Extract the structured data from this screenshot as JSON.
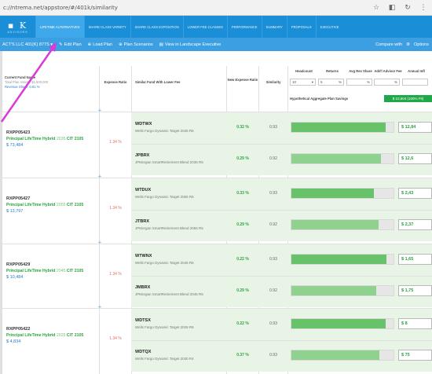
{
  "browser": {
    "url": "c://ntrema.net/appstore/#/401k/similarity",
    "icons": [
      "star-icon",
      "extensions-icon",
      "refresh-icon",
      "menu-icon"
    ]
  },
  "brand": {
    "logo": "▪ K",
    "logo_sub": "ADVISORS"
  },
  "nav": {
    "tabs": [
      {
        "label": "Lifetime Alternatives",
        "active": true
      },
      {
        "label": "Share Class Variety",
        "active": false
      },
      {
        "label": "Share Class Exposition",
        "active": false
      },
      {
        "label": "Lower Fee Classes",
        "active": false
      },
      {
        "label": "Performance",
        "active": false
      },
      {
        "label": "Summary",
        "active": false
      },
      {
        "label": "Proposals",
        "active": false
      },
      {
        "label": "Executive",
        "active": false
      }
    ]
  },
  "subbar": {
    "plan": "ACT'S LLC 401(K) 877S ▾",
    "actions": [
      {
        "icon": "edit-icon",
        "label": "Edit Plan"
      },
      {
        "icon": "plus-icon",
        "label": "Load Plan"
      },
      {
        "icon": "plus-icon",
        "label": "Plan Scenarios"
      },
      {
        "icon": "list-icon",
        "label": "View in Landscape Executive"
      }
    ],
    "compare": "Compare with",
    "options": "Options"
  },
  "table": {
    "headers": {
      "current": "Current Fund Name",
      "current_sub1": "Total Plan Assets: $1,500,000",
      "current_sub2": "Revenue Share: 0.81 %",
      "expense": "Expense Ratio",
      "similar": "Similar Fund With Lower Fee",
      "new_expense": "New Expense Ratio",
      "similarity": "Similarity"
    },
    "filters": {
      "headers": [
        "Headcount",
        "Returns",
        "Avg Rev Share",
        "Add'l Advisor Fee",
        "Annual Infl"
      ],
      "values": [
        "10",
        "5",
        "",
        "",
        ""
      ],
      "units": [
        "▾",
        "%",
        "%",
        "%",
        ""
      ],
      "savings_label": "Hypothetical Aggregate Plan Savings",
      "savings_value": "$ 10,604 (100% Fit)"
    },
    "groups": [
      {
        "ticker": "RXPP05423",
        "name": "Principal LifeTime Hybrid",
        "year": "2035",
        "cit": "CIT 2105",
        "amount": "$ 73,484",
        "expense": "1.34 %",
        "similar": [
          {
            "ticker": "WDTWX",
            "name": "Wells Fargo Dynamic Target 2035 R6",
            "new_exp": "0.32 %",
            "similarity": "0.93",
            "fit": 0.92,
            "saving": "$ 12,84"
          },
          {
            "ticker": "JPBRX",
            "name": "JPMorgan SmartRetirement Blend 2035 R5",
            "new_exp": "0.29 %",
            "similarity": "0.92",
            "fit": 0.88,
            "saving": "$ 12,6"
          }
        ]
      },
      {
        "ticker": "RXPP05427",
        "name": "Principal LifeTime Hybrid",
        "year": "2055",
        "cit": "CIT 2105",
        "amount": "$ 13,797",
        "expense": "1.34 %",
        "similar": [
          {
            "ticker": "WTDUX",
            "name": "Wells Fargo Dynamic Target 2055 R6",
            "new_exp": "0.33 %",
            "similarity": "0.93",
            "fit": 0.81,
            "saving": "$ 2,43"
          },
          {
            "ticker": "JTBRX",
            "name": "JPMorgan SmartRetirement Blend 2055 R5",
            "new_exp": "0.29 %",
            "similarity": "0.92",
            "fit": 0.85,
            "saving": "$ 2,37"
          }
        ]
      },
      {
        "ticker": "RXPP05429",
        "name": "Principal LifeTime Hybrid",
        "year": "2045",
        "cit": "CIT 2105",
        "amount": "$ 10,484",
        "expense": "1.34 %",
        "similar": [
          {
            "ticker": "WTWNX",
            "name": "Wells Fargo Dynamic Target 2045 R6",
            "new_exp": "0.22 %",
            "similarity": "0.93",
            "fit": 0.93,
            "saving": "$ 1,65"
          },
          {
            "ticker": "JMBRX",
            "name": "JPMorgan SmartRetirement Blend 2045 R5",
            "new_exp": "0.29 %",
            "similarity": "0.92",
            "fit": 0.83,
            "saving": "$ 1,75"
          }
        ]
      },
      {
        "ticker": "RXPP05422",
        "name": "Principal LifeTime Hybrid",
        "year": "2025",
        "cit": "CIT 2105",
        "amount": "$ 4,834",
        "expense": "1.34 %",
        "similar": [
          {
            "ticker": "WDTSX",
            "name": "Wells Fargo Dynamic Target 2025 R6",
            "new_exp": "0.22 %",
            "similarity": "0.93",
            "fit": 0.92,
            "saving": "$ 8"
          },
          {
            "ticker": "WDTQX",
            "name": "Wells Fargo Dynamic Target 2030 R4",
            "new_exp": "0.37 %",
            "similarity": "0.93",
            "fit": 0.86,
            "saving": "$ 75"
          }
        ]
      }
    ]
  },
  "colors": {
    "nav": "#1a8fd8",
    "subbar": "#3b9fe2",
    "green": "#2aa33d",
    "bar": "#67c26a",
    "annotation_arrow": "#d93ad9"
  }
}
